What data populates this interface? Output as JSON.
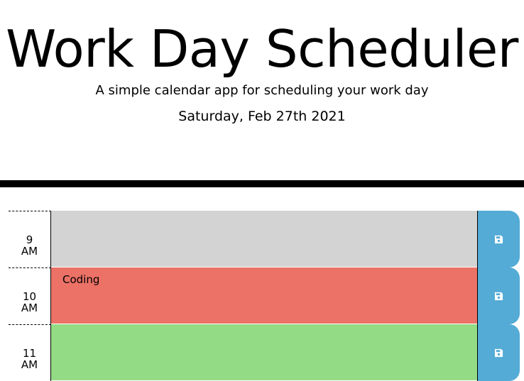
{
  "header": {
    "title": "Work Day Scheduler",
    "subtitle": "A simple calendar app for scheduling your work day",
    "current_day": "Saturday, Feb 27th 2021"
  },
  "timeblocks": [
    {
      "hour_number": "9",
      "hour_suffix": "AM",
      "description": "",
      "state": "past",
      "color": "#d3d3d3",
      "save_icon": "save-icon"
    },
    {
      "hour_number": "10",
      "hour_suffix": "AM",
      "description": "Coding",
      "state": "present",
      "color": "#ec7166",
      "save_icon": "save-icon"
    },
    {
      "hour_number": "11",
      "hour_suffix": "AM",
      "description": "",
      "state": "future",
      "color": "#93db84",
      "save_icon": "save-icon"
    }
  ],
  "colors": {
    "past": "#d3d3d3",
    "present": "#ec7166",
    "future": "#93db84",
    "save_button": "#53abd6",
    "divider": "#000000"
  }
}
